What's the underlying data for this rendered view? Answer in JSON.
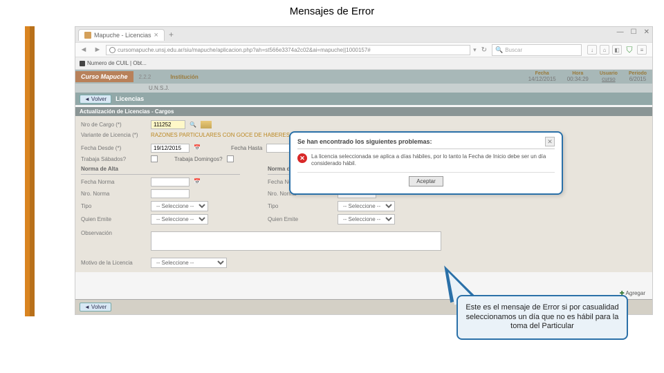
{
  "slide": {
    "title": "Mensajes de Error"
  },
  "browser": {
    "tab_title": "Mapuche - Licencias",
    "url": "cursomapuche.unsj.edu.ar/siu/mapuche/aplicacion.php?ah=st566e3374a2c02&ai=mapuche||1000157#",
    "search_placeholder": "Buscar",
    "bookmark": "Numero de CUIL | Obt..."
  },
  "app": {
    "brand": "Curso Mapuche",
    "version": "2.2.2",
    "inst_label": "Institución",
    "inst_value": "U.N.S.J.",
    "fecha_label": "Fecha",
    "fecha_value": "14/12/2015",
    "hora_label": "Hora",
    "hora_value": "00:34:29",
    "usuario_label": "Usuario",
    "usuario_value": "curso",
    "periodo_label": "Periodo",
    "periodo_value": "6/2015",
    "volver": "Volver",
    "subtitle": "Licencias",
    "section": "Actualización de Licencias - Cargos"
  },
  "form": {
    "nro_cargo_label": "Nro de Cargo (*)",
    "nro_cargo_value": "111252",
    "variante_label": "Variante de Licencia (*)",
    "variante_value": "RAZONES PARTICULARES CON GOCE DE HABERES",
    "fecha_desde_label": "Fecha Desde (*)",
    "fecha_desde_value": "19/12/2015",
    "fecha_hasta_label": "Fecha Hasta",
    "sabados": "Trabaja Sábados?",
    "domingos": "Trabaja Domingos?",
    "norma_alta": "Norma de Alta",
    "norma_baja": "Norma de Baja",
    "fecha_norma": "Fecha Norma",
    "nro_norma": "Nro. Norma",
    "tipo": "Tipo",
    "emite": "Quien Emite",
    "seleccione": "-- Seleccione --",
    "observacion": "Observación",
    "motivo": "Motivo de la Licencia",
    "agregar": "Agregar"
  },
  "modal": {
    "title": "Se han encontrado los siguientes problemas:",
    "message": "La licencia seleccionada se aplica a días hábiles, por lo tanto la Fecha de Inicio debe ser un día considerado hábil.",
    "accept": "Aceptar"
  },
  "callout": {
    "text": "Este es el mensaje de Error si por casualidad seleccionamos un día que no es hábil para la toma del Particular"
  }
}
